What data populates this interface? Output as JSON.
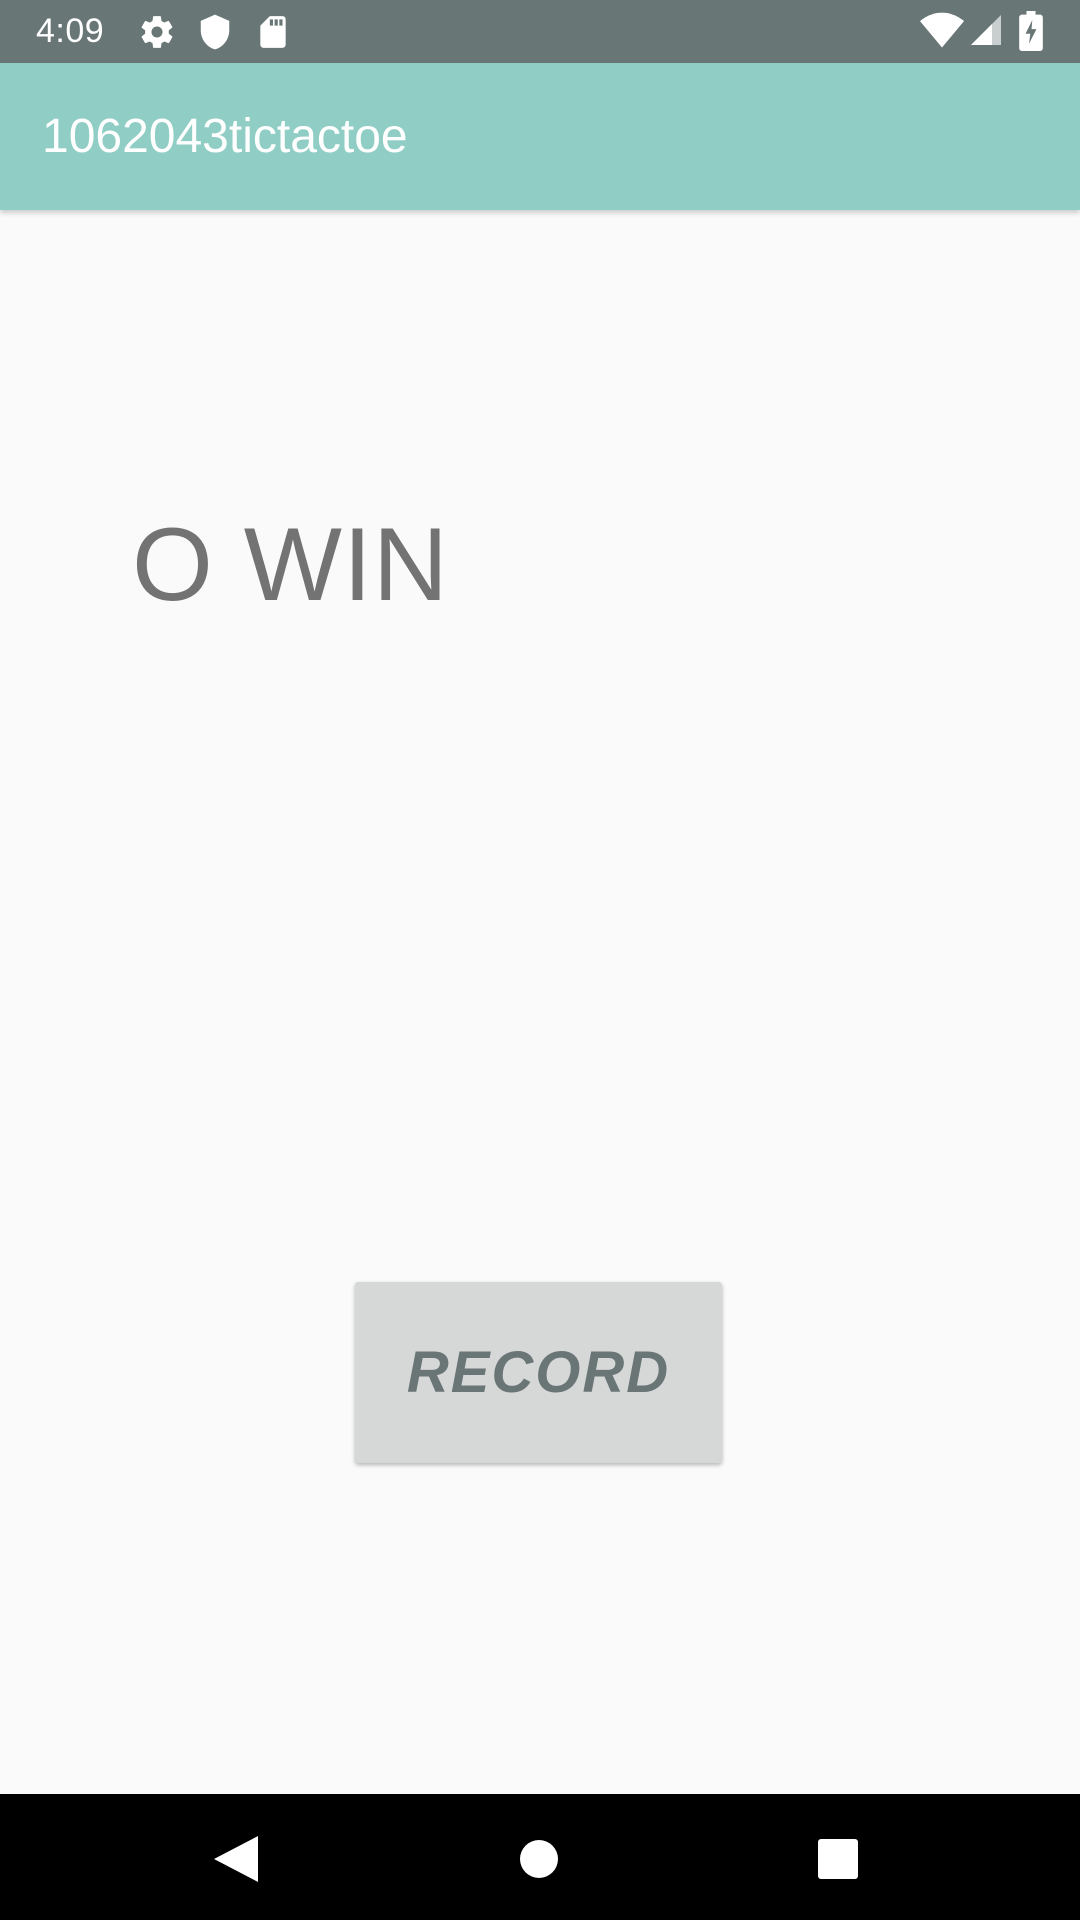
{
  "status_bar": {
    "time": "4:09",
    "icons_left": [
      "settings-gear-icon",
      "shield-icon",
      "sd-card-icon"
    ],
    "icons_right": [
      "wifi-icon",
      "cell-signal-icon",
      "battery-charging-icon"
    ],
    "background": "#697676"
  },
  "app_bar": {
    "title": "1062043tictactoe",
    "background": "#8fcdc5"
  },
  "main": {
    "result_text": "O WIN",
    "record_button_label": "RECORD"
  },
  "nav_bar": {
    "buttons": [
      "back-icon",
      "home-icon",
      "recents-icon"
    ]
  }
}
